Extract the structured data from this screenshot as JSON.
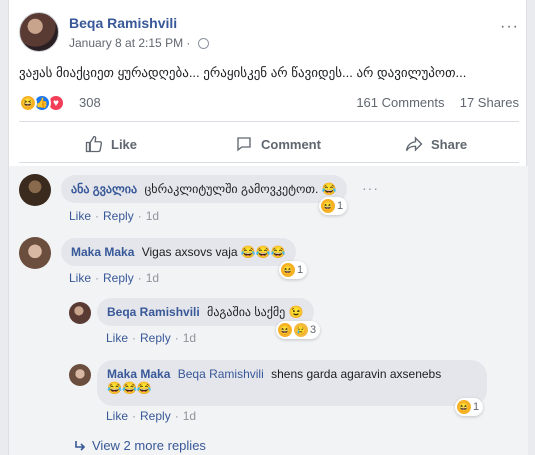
{
  "post": {
    "author": "Beqa Ramishvili",
    "date": "January 8 at 2:15 PM",
    "separator": "·",
    "text": "ვაჟას მიაქციეთ ყურადღება... ერაყისკენ არ წავიდეს... არ დავილუპოთ...",
    "reaction_count": "308",
    "comments_count": "161 Comments",
    "shares_count": "17 Shares",
    "more_label": "···"
  },
  "actions": {
    "like": "Like",
    "comment": "Comment",
    "share": "Share"
  },
  "comments": [
    {
      "name": "ანა გვალია",
      "text": "ცხრაკლიტულში გამოვკეტოთ.",
      "emoji": "😂",
      "like": "Like",
      "reply": "Reply",
      "time": "1d",
      "react_count": "1"
    },
    {
      "name": "Maka Maka",
      "text": "Vigas axsovs vaja",
      "emoji": "😂😂😂",
      "like": "Like",
      "reply": "Reply",
      "time": "1d",
      "react_count": "1"
    },
    {
      "name": "Beqa Ramishvili",
      "text": "მაგაშია საქმე",
      "emoji": "😉",
      "like": "Like",
      "reply": "Reply",
      "time": "1d",
      "react_count": "3"
    },
    {
      "name": "Maka Maka",
      "tag": "Beqa Ramishvili",
      "text": "shens garda agaravin axsenebs",
      "emoji": "😂😂😂",
      "like": "Like",
      "reply": "Reply",
      "time": "1d",
      "react_count": "1"
    }
  ],
  "view_more": "View 2 more replies",
  "colors": {
    "link": "#385898",
    "like_blue": "#1877f2",
    "love_red": "#f33e58",
    "haha_yellow": "#f7b125"
  }
}
